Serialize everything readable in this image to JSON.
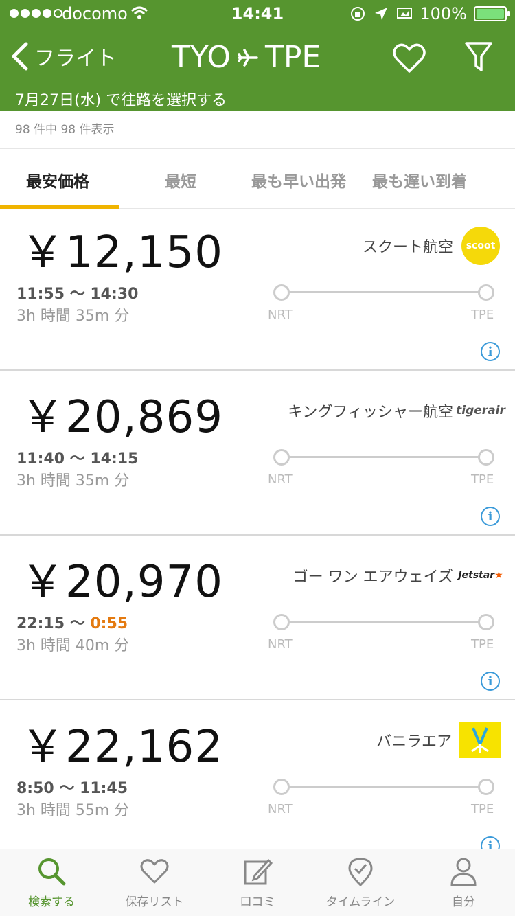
{
  "status_bar": {
    "carrier": "docomo",
    "time": "14:41",
    "battery": "100%",
    "battery_color": "#7be07b"
  },
  "nav": {
    "back_label": "フライト",
    "origin": "TYO",
    "destination": "TPE",
    "icons": [
      "chevron-left-icon",
      "plane-icon",
      "heart-icon",
      "filter-icon"
    ]
  },
  "subtitle": "7月27日(水) で往路を選択する",
  "result_count": "98 件中 98 件表示",
  "sort_tabs": [
    {
      "label": "最安価格",
      "active": true
    },
    {
      "label": "最短",
      "active": false
    },
    {
      "label": "最も早い出発",
      "active": false
    },
    {
      "label": "最も遅い到着",
      "active": false
    }
  ],
  "flights": [
    {
      "price": "￥12,150",
      "airline": "スクート航空",
      "logo": "scoot",
      "depart": "11:55",
      "arrive": "14:30",
      "arrive_next_day": false,
      "duration": "3h 時間 35m 分",
      "from": "NRT",
      "to": "TPE"
    },
    {
      "price": "￥20,869",
      "airline": "キングフィッシャー航空",
      "logo": "tigerair",
      "depart": "11:40",
      "arrive": "14:15",
      "arrive_next_day": false,
      "duration": "3h 時間 35m 分",
      "from": "NRT",
      "to": "TPE"
    },
    {
      "price": "￥20,970",
      "airline": "ゴー ワン エアウェイズ",
      "logo": "Jetstar",
      "depart": "22:15",
      "arrive": "0:55",
      "arrive_next_day": true,
      "duration": "3h 時間 40m 分",
      "from": "NRT",
      "to": "TPE"
    },
    {
      "price": "￥22,162",
      "airline": "バニラエア",
      "logo": "vanilla",
      "depart": "8:50",
      "arrive": "11:45",
      "arrive_next_day": false,
      "duration": "3h 時間 55m 分",
      "from": "NRT",
      "to": "TPE"
    }
  ],
  "tab_bar": [
    {
      "label": "検索する",
      "icon": "search-icon",
      "active": true
    },
    {
      "label": "保存リスト",
      "icon": "heart-icon",
      "active": false
    },
    {
      "label": "口コミ",
      "icon": "edit-icon",
      "active": false
    },
    {
      "label": "タイムライン",
      "icon": "map-pin-icon",
      "active": false
    },
    {
      "label": "自分",
      "icon": "user-icon",
      "active": false
    }
  ],
  "colors": {
    "header": "#56952f",
    "tab_indicator": "#f0b400",
    "next_day_arrival": "#e47a10",
    "info": "#3a9ad9"
  }
}
